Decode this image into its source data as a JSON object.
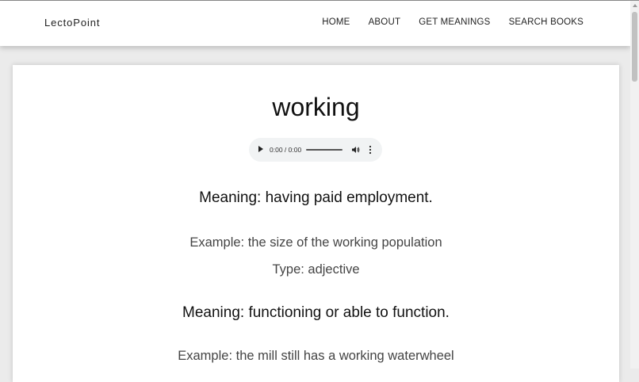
{
  "nav": {
    "brand": "LectoPoint",
    "links": [
      "HOME",
      "ABOUT",
      "GET MEANINGS",
      "SEARCH BOOKS"
    ]
  },
  "word": {
    "title": "working",
    "audio_time": "0:00 / 0:00"
  },
  "entries": [
    {
      "meaning": "Meaning: having paid employment.",
      "example": "Example: the size of the working population",
      "type": "Type: adjective"
    },
    {
      "meaning": "Meaning: functioning or able to function.",
      "example": "Example: the mill still has a working waterwheel"
    }
  ],
  "icons": {
    "play": "play-icon",
    "volume": "volume-icon",
    "more": "more-vert-icon"
  }
}
